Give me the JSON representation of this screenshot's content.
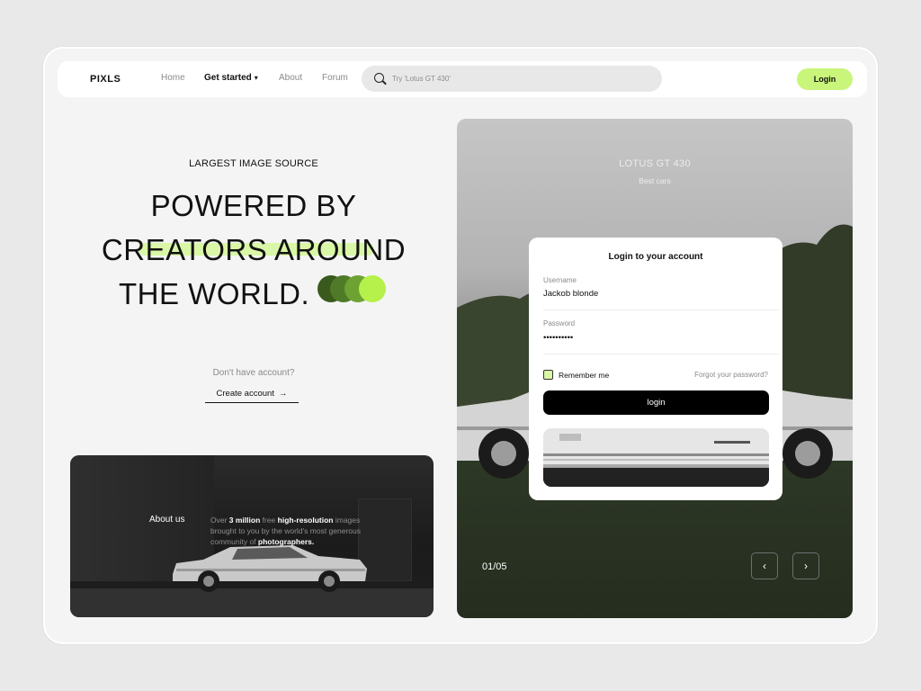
{
  "nav": {
    "logo": "PIXLS",
    "links": [
      {
        "label": "Home",
        "active": false
      },
      {
        "label": "Get started",
        "active": true,
        "has_dropdown": true
      },
      {
        "label": "About",
        "active": false
      },
      {
        "label": "Forum",
        "active": false
      }
    ],
    "search_placeholder": "Try 'Lotus GT 430'",
    "login_label": "Login"
  },
  "hero": {
    "eyebrow": "LARGEST IMAGE SOURCE",
    "headline_lines": [
      "POWERED BY",
      "CREATORS AROUND",
      "THE WORLD."
    ],
    "dot_colors": [
      "#3a5a1d",
      "#4f7a27",
      "#6ea334",
      "#b6f04a"
    ],
    "question": "Don't have account?",
    "create_label": "Create account",
    "create_icon": "arrow-right-icon"
  },
  "about": {
    "title": "About us",
    "text_prefix": "Over ",
    "text_bold_1": "3 million",
    "text_mid_1": " free ",
    "text_bold_2": "high-resolution",
    "text_mid_2": " images brought to you by the world's most generous community of ",
    "text_bold_3": "photographers."
  },
  "hero_card": {
    "model": "LOTUS GT 430",
    "subtitle": "Best cars",
    "counter": "01/05",
    "prev_icon": "chevron-left-icon",
    "next_icon": "chevron-right-icon"
  },
  "login_panel": {
    "title": "Login to your account",
    "username_label": "Username",
    "username_value": "Jackob blonde",
    "password_label": "Password",
    "password_value": "••••••••••",
    "remember_label": "Remember me",
    "remember_checked": true,
    "forgot_label": "Forgot your password?",
    "submit_label": "login"
  },
  "colors": {
    "accent": "#c9f57a",
    "highlight": "#d9f7a6",
    "dark": "#000000"
  }
}
